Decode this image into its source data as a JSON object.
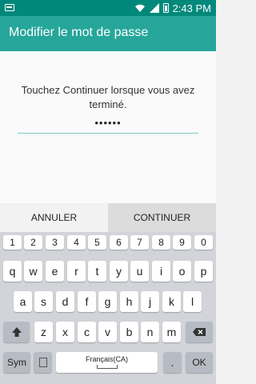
{
  "status_bar": {
    "time": "2:43 PM"
  },
  "app_bar": {
    "title": "Modifier le mot de passe"
  },
  "content": {
    "instruction": "Touchez Continuer lorsque vous avez terminé.",
    "password_mask": "••••••"
  },
  "actions": {
    "cancel": "ANNULER",
    "continue": "CONTINUER"
  },
  "keyboard": {
    "row_numbers": [
      "1",
      "2",
      "3",
      "4",
      "5",
      "6",
      "7",
      "8",
      "9",
      "0"
    ],
    "row1": [
      "q",
      "w",
      "e",
      "r",
      "t",
      "y",
      "u",
      "i",
      "o",
      "p"
    ],
    "row2": [
      "a",
      "s",
      "d",
      "f",
      "g",
      "h",
      "j",
      "k",
      "l"
    ],
    "row3": [
      "z",
      "x",
      "c",
      "v",
      "b",
      "n",
      "m"
    ],
    "sym": "Sym",
    "space_label": "Français(CA)",
    "period": ".",
    "ok": "OK"
  }
}
